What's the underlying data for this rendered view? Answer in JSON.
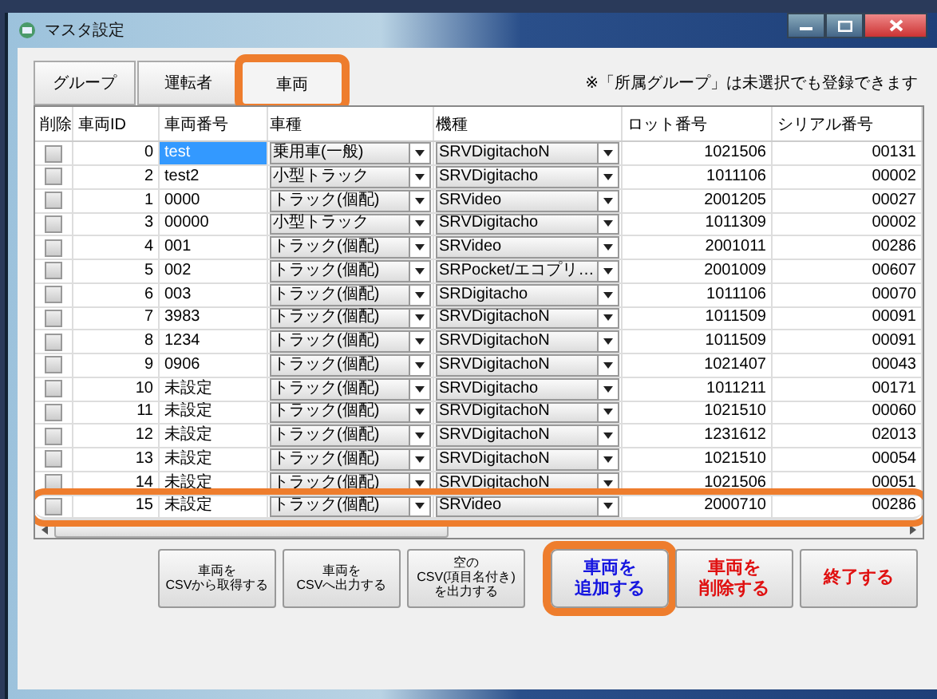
{
  "window": {
    "title": "マスタ設定"
  },
  "tabs": [
    {
      "label": "グループ",
      "selected": false,
      "highlighted": false
    },
    {
      "label": "運転者",
      "selected": false,
      "highlighted": false
    },
    {
      "label": "車両",
      "selected": true,
      "highlighted": true
    }
  ],
  "note": "※「所属グループ」は未選択でも登録できます",
  "table": {
    "columns": [
      "削除",
      "車両ID",
      "車両番号",
      "車種",
      "機種",
      "ロット番号",
      "シリアル番号"
    ],
    "rows": [
      {
        "checked": false,
        "id": "0",
        "number": "test",
        "type": "乗用車(一般)",
        "model": "SRVDigitachoN",
        "lot": "1021506",
        "serial": "00131",
        "selected": true,
        "highlighted": false
      },
      {
        "checked": false,
        "id": "2",
        "number": "test2",
        "type": "小型トラック",
        "model": "SRVDigitacho",
        "lot": "1011106",
        "serial": "00002",
        "selected": false,
        "highlighted": false
      },
      {
        "checked": false,
        "id": "1",
        "number": "0000",
        "type": "トラック(個配)",
        "model": "SRVideo",
        "lot": "2001205",
        "serial": "00027",
        "selected": false,
        "highlighted": false
      },
      {
        "checked": false,
        "id": "3",
        "number": "00000",
        "type": "小型トラック",
        "model": "SRVDigitacho",
        "lot": "1011309",
        "serial": "00002",
        "selected": false,
        "highlighted": false
      },
      {
        "checked": false,
        "id": "4",
        "number": "001",
        "type": "トラック(個配)",
        "model": "SRVideo",
        "lot": "2001011",
        "serial": "00286",
        "selected": false,
        "highlighted": false
      },
      {
        "checked": false,
        "id": "5",
        "number": "002",
        "type": "トラック(個配)",
        "model": "SRPocket/エコプリ…",
        "lot": "2001009",
        "serial": "00607",
        "selected": false,
        "highlighted": false
      },
      {
        "checked": false,
        "id": "6",
        "number": "003",
        "type": "トラック(個配)",
        "model": "SRDigitacho",
        "lot": "1011106",
        "serial": "00070",
        "selected": false,
        "highlighted": false
      },
      {
        "checked": false,
        "id": "7",
        "number": "3983",
        "type": "トラック(個配)",
        "model": "SRVDigitachoN",
        "lot": "1011509",
        "serial": "00091",
        "selected": false,
        "highlighted": false
      },
      {
        "checked": false,
        "id": "8",
        "number": "1234",
        "type": "トラック(個配)",
        "model": "SRVDigitachoN",
        "lot": "1011509",
        "serial": "00091",
        "selected": false,
        "highlighted": false
      },
      {
        "checked": false,
        "id": "9",
        "number": "0906",
        "type": "トラック(個配)",
        "model": "SRVDigitachoN",
        "lot": "1021407",
        "serial": "00043",
        "selected": false,
        "highlighted": false
      },
      {
        "checked": false,
        "id": "10",
        "number": "未設定",
        "type": "トラック(個配)",
        "model": "SRVDigitacho",
        "lot": "1011211",
        "serial": "00171",
        "selected": false,
        "highlighted": false
      },
      {
        "checked": false,
        "id": "11",
        "number": "未設定",
        "type": "トラック(個配)",
        "model": "SRVDigitachoN",
        "lot": "1021510",
        "serial": "00060",
        "selected": false,
        "highlighted": false
      },
      {
        "checked": false,
        "id": "12",
        "number": "未設定",
        "type": "トラック(個配)",
        "model": "SRVDigitachoN",
        "lot": "1231612",
        "serial": "02013",
        "selected": false,
        "highlighted": false
      },
      {
        "checked": false,
        "id": "13",
        "number": "未設定",
        "type": "トラック(個配)",
        "model": "SRVDigitachoN",
        "lot": "1021510",
        "serial": "00054",
        "selected": false,
        "highlighted": false
      },
      {
        "checked": false,
        "id": "14",
        "number": "未設定",
        "type": "トラック(個配)",
        "model": "SRVDigitachoN",
        "lot": "1021506",
        "serial": "00051",
        "selected": false,
        "highlighted": false
      },
      {
        "checked": false,
        "id": "15",
        "number": "未設定",
        "type": "トラック(個配)",
        "model": "SRVideo",
        "lot": "2000710",
        "serial": "00286",
        "selected": false,
        "highlighted": true
      }
    ]
  },
  "buttons": [
    {
      "lines": [
        "車両を",
        "CSVから取得する"
      ],
      "kind": "plain",
      "highlighted": false
    },
    {
      "lines": [
        "車両を",
        "CSVへ出力する"
      ],
      "kind": "plain",
      "highlighted": false
    },
    {
      "lines": [
        "空の",
        "CSV(項目名付き)",
        "を出力する"
      ],
      "kind": "plain",
      "highlighted": false
    },
    {
      "lines": [
        "車両を",
        "追加する"
      ],
      "kind": "add",
      "highlighted": true
    },
    {
      "lines": [
        "車両を",
        "削除する"
      ],
      "kind": "danger",
      "highlighted": false
    },
    {
      "lines": [
        "終了する"
      ],
      "kind": "danger",
      "highlighted": false
    }
  ]
}
